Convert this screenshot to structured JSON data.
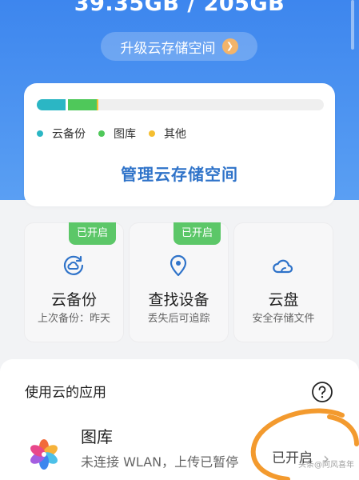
{
  "storage": {
    "usage_text": "39.35GB / 205GB",
    "upgrade_label": "升级云存储空间",
    "manage_label": "管理云存储空间",
    "usage_fractions": {
      "backup": 0.1,
      "gallery": 0.1,
      "other": 0.005
    },
    "legend": [
      {
        "label": "云备份",
        "color": "#2bb6c4"
      },
      {
        "label": "图库",
        "color": "#4fc85a"
      },
      {
        "label": "其他",
        "color": "#f5be30"
      }
    ]
  },
  "services": [
    {
      "title": "云备份",
      "subtitle": "上次备份：昨天",
      "badge": "已开启",
      "icon": "cloud-backup-icon"
    },
    {
      "title": "查找设备",
      "subtitle": "丢失后可追踪",
      "badge": "已开启",
      "icon": "location-pin-icon"
    },
    {
      "title": "云盘",
      "subtitle": "安全存储文件",
      "icon": "cloud-drive-icon"
    }
  ],
  "apps": {
    "heading": "使用云的应用",
    "items": [
      {
        "title": "图库",
        "description": "未连接 WLAN，上传已暂停",
        "status": "已开启",
        "icon": "gallery-pinwheel-icon"
      }
    ]
  },
  "watermark": "头条@阿风喜年",
  "colors": {
    "hero_blue": "#3d86ee",
    "badge_green": "#5cc768",
    "link_blue": "#2f73c9",
    "annotation_orange": "#f39a2e"
  }
}
